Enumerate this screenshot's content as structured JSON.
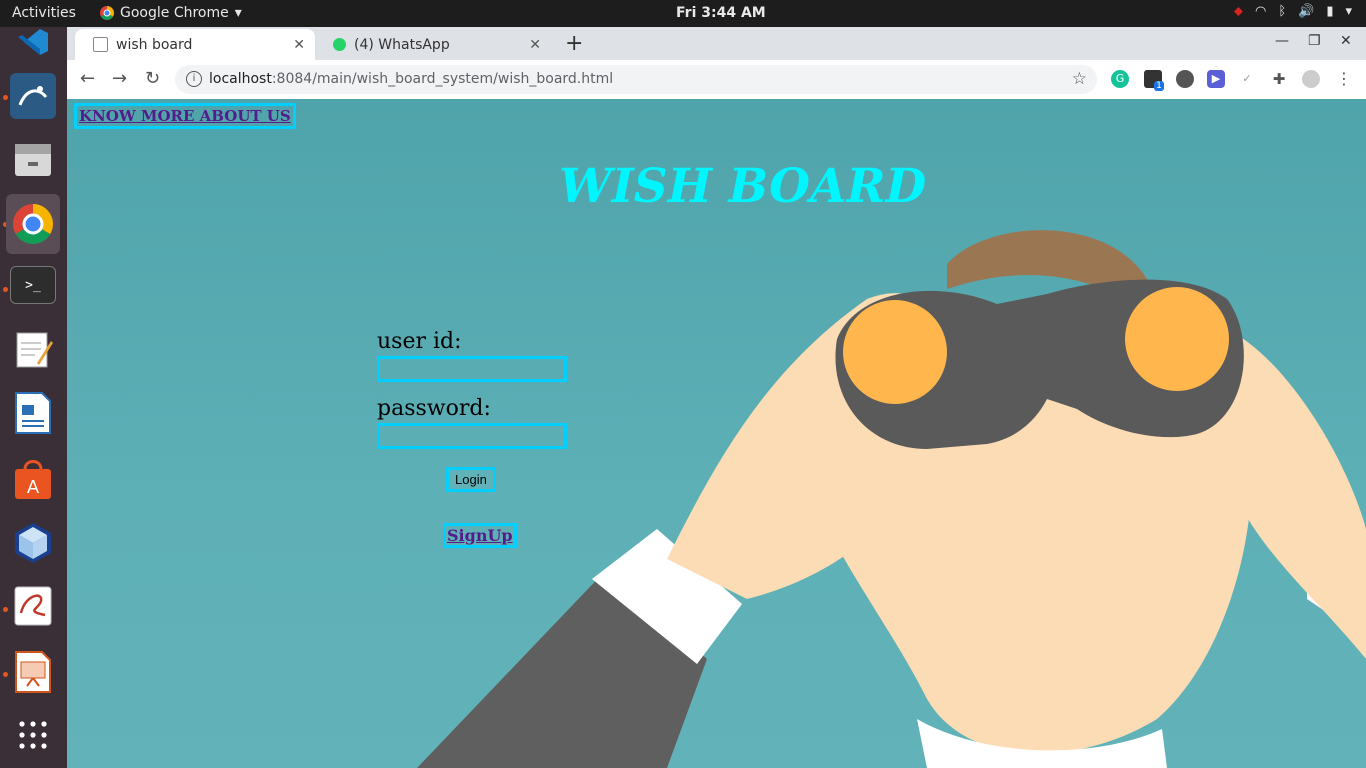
{
  "system": {
    "activities": "Activities",
    "app_name": "Google Chrome",
    "clock": "Fri  3:44 AM"
  },
  "dock": {
    "items": [
      "vscode-icon",
      "mysql-workbench-icon",
      "files-icon",
      "chrome-icon",
      "terminal-icon",
      "text-editor-icon",
      "libreoffice-writer-icon",
      "software-center-icon",
      "virtualbox-icon",
      "document-viewer-icon",
      "libreoffice-impress-icon",
      "app-grid-icon"
    ]
  },
  "browser": {
    "tabs": [
      {
        "title": "wish board",
        "active": true
      },
      {
        "title": "(4) WhatsApp",
        "active": false
      }
    ],
    "url_host": "localhost",
    "url_rest": ":8084/main/wish_board_system/wish_board.html",
    "extension_badge": "1"
  },
  "page": {
    "know_more": "KNOW MORE ABOUT US",
    "title": "WISH BOARD",
    "userid_label": "user id:",
    "userid_value": "",
    "password_label": "password:",
    "password_value": "",
    "login_label": "Login",
    "signup_label": "SignUp"
  },
  "colors": {
    "title": "#00f5ff",
    "input_border": "#00cfff",
    "page_bg": "#5ab0b6",
    "link": "#551a8b"
  }
}
